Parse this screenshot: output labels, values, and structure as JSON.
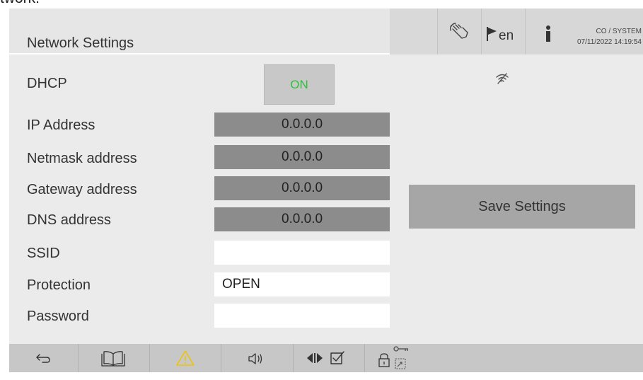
{
  "window_title_fragment": "twork:",
  "header": {
    "title": "Network Settings",
    "language": "en",
    "user": "CO / SYSTEM",
    "timestamp": "07/11/2022 14:19:54"
  },
  "dhcp": {
    "label": "DHCP",
    "value": "ON",
    "value_color": "#2fbf3a"
  },
  "fields": [
    {
      "label": "IP Address",
      "value": "0.0.0.0",
      "editable": false
    },
    {
      "label": "Netmask address",
      "value": "0.0.0.0",
      "editable": false
    },
    {
      "label": "Gateway address",
      "value": "0.0.0.0",
      "editable": false
    },
    {
      "label": "DNS address",
      "value": "0.0.0.0",
      "editable": false
    },
    {
      "label": "SSID",
      "value": "",
      "editable": true
    },
    {
      "label": "Protection",
      "value": "OPEN",
      "editable": true
    },
    {
      "label": "Password",
      "value": "",
      "editable": true
    }
  ],
  "wifi_status_icon": "wifi-off-icon",
  "save_button": {
    "label": "Save Settings"
  },
  "toolbar_icons": [
    "touch-hand-icon",
    "flag-icon",
    "user-info-icon"
  ],
  "footer_icons": [
    "back-arrow-icon",
    "book-manual-icon",
    "warning-icon",
    "speaker-volume-icon",
    "arrows-check-icon",
    "lock-icon",
    "key-icon",
    "exit-icon"
  ],
  "colors": {
    "warning": "#f0c400",
    "on_green": "#2fbf3a"
  }
}
